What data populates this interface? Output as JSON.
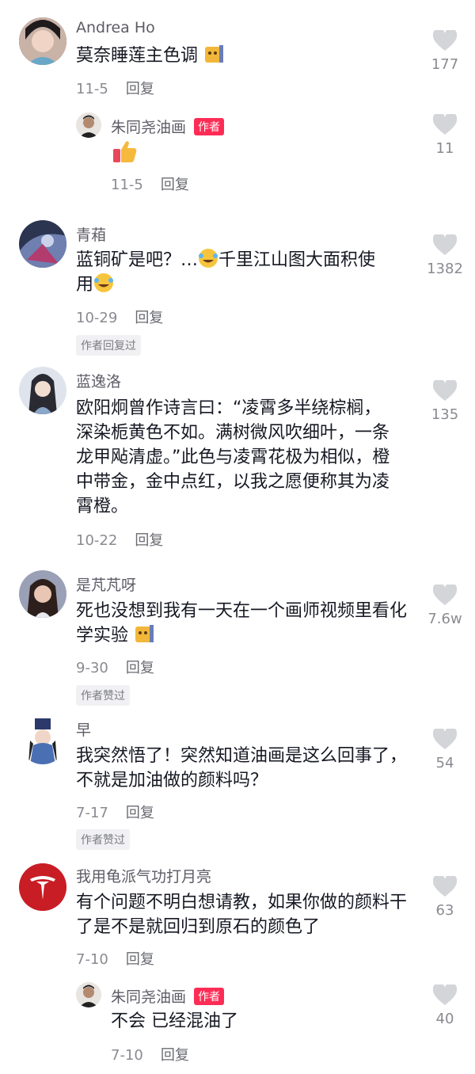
{
  "colors": {
    "accent": "#fe2c55",
    "muted": "#8a8b91",
    "text": "#161823"
  },
  "reply_label": "回复",
  "comments": [
    {
      "name": "Andrea Ho",
      "text": "莫奈睡莲主色调",
      "emoji": "cat-emoji",
      "date": "11-5",
      "likes": "177"
    },
    {
      "name": "朱同尧油画",
      "author_tag": "作者",
      "text": "",
      "emoji": "thumbs-up-emoji",
      "date": "11-5",
      "likes": "11"
    },
    {
      "name": "青葙",
      "text1": "蓝铜矿是吧？…",
      "text2": "千里江山图大面积使",
      "text3": "用",
      "date": "10-29",
      "badge": "作者回复过",
      "likes": "1382"
    },
    {
      "name": "蓝逸洛",
      "text": "欧阳炯曾作诗言曰：“凌霄多半绕棕榈，深染栀黄色不如。满树微风吹细叶，一条龙甲飐清虚。”此色与凌霄花极为相似，橙中带金，金中点红，以我之愿便称其为凌霄橙。",
      "date": "10-22",
      "likes": "135"
    },
    {
      "name": "是芃芃呀",
      "text": "死也没想到我有一天在一个画师视频里看化学实验",
      "date": "9-30",
      "badge": "作者赞过",
      "likes": "7.6w"
    },
    {
      "name": "早",
      "text": "我突然悟了！突然知道油画是这么回事了，不就是加油做的颜料吗？",
      "date": "7-17",
      "badge": "作者赞过",
      "likes": "54"
    },
    {
      "name": "我用龟派气功打月亮",
      "text": "有个问题不明白想请教，如果你做的颜料干了是不是就回归到原石的颜色了",
      "date": "7-10",
      "likes": "63"
    },
    {
      "name": "朱同尧油画",
      "author_tag": "作者",
      "text": "不会 已经混油了",
      "date": "7-10",
      "likes": "40"
    }
  ]
}
